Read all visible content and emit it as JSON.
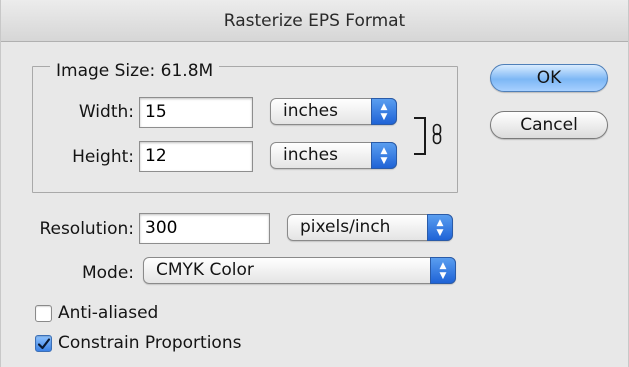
{
  "window": {
    "title": "Rasterize EPS Format"
  },
  "image_size": {
    "legend": "Image Size: 61.8M"
  },
  "width": {
    "label": "Width:",
    "value": "15",
    "unit": "inches"
  },
  "height": {
    "label": "Height:",
    "value": "12",
    "unit": "inches"
  },
  "resolution": {
    "label": "Resolution:",
    "value": "300",
    "unit": "pixels/inch"
  },
  "mode": {
    "label": "Mode:",
    "value": "CMYK Color"
  },
  "buttons": {
    "ok": "OK",
    "cancel": "Cancel"
  },
  "options": {
    "anti_aliased": {
      "label": "Anti-aliased",
      "checked": false
    },
    "constrain": {
      "label": "Constrain Proportions",
      "checked": true
    }
  },
  "colors": {
    "default_button": "#7db7f5",
    "popup_arrows": "#1f63d6"
  }
}
